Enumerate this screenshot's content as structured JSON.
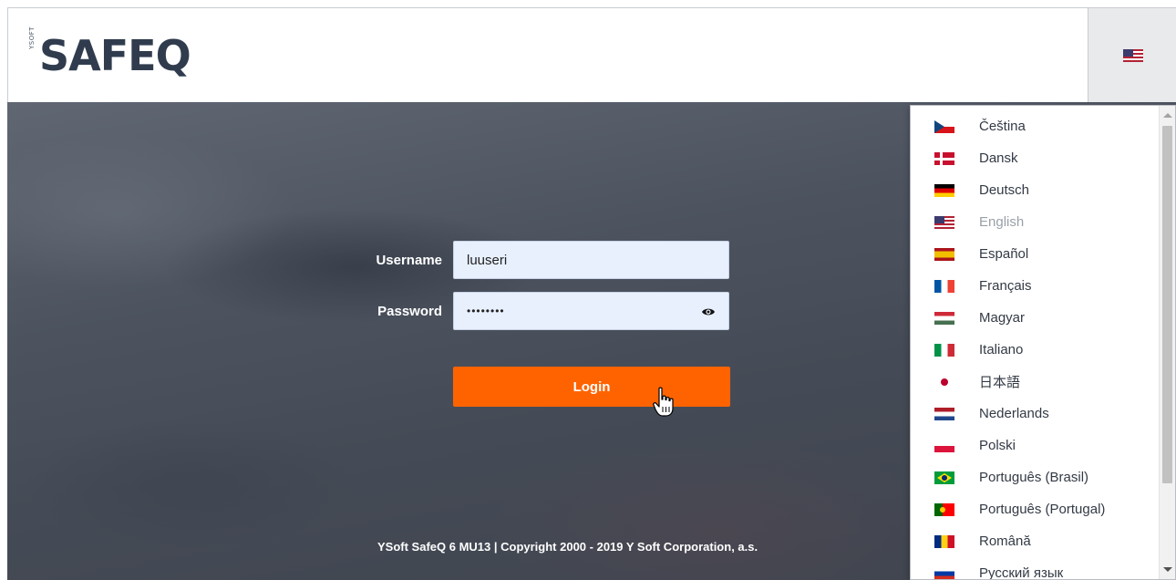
{
  "header": {
    "logo_text": "SAFEQ",
    "logo_side_text": "YSOFT",
    "current_language_flag": "us-flag-icon"
  },
  "login": {
    "username_label": "Username",
    "username_value": "luuseri",
    "password_label": "Password",
    "password_value": "••••••••",
    "login_label": "Login"
  },
  "footer": {
    "text": "YSoft SafeQ 6 MU13 | Copyright 2000 - 2019 Y Soft Corporation, a.s."
  },
  "languages": [
    {
      "label": "Čeština",
      "flag": "cz",
      "disabled": false
    },
    {
      "label": "Dansk",
      "flag": "dk",
      "disabled": false
    },
    {
      "label": "Deutsch",
      "flag": "de",
      "disabled": false
    },
    {
      "label": "English",
      "flag": "us",
      "disabled": true
    },
    {
      "label": "Español",
      "flag": "es",
      "disabled": false
    },
    {
      "label": "Français",
      "flag": "fr",
      "disabled": false
    },
    {
      "label": "Magyar",
      "flag": "hu",
      "disabled": false
    },
    {
      "label": "Italiano",
      "flag": "it",
      "disabled": false
    },
    {
      "label": "日本語",
      "flag": "jp",
      "disabled": false
    },
    {
      "label": "Nederlands",
      "flag": "nl",
      "disabled": false
    },
    {
      "label": "Polski",
      "flag": "pl",
      "disabled": false
    },
    {
      "label": "Português (Brasil)",
      "flag": "br",
      "disabled": false
    },
    {
      "label": "Português (Portugal)",
      "flag": "pt",
      "disabled": false
    },
    {
      "label": "Română",
      "flag": "ro",
      "disabled": false
    },
    {
      "label": "Русский язык",
      "flag": "ru",
      "disabled": false
    }
  ],
  "colors": {
    "accent": "#ff6300",
    "logo": "#303c4e"
  }
}
